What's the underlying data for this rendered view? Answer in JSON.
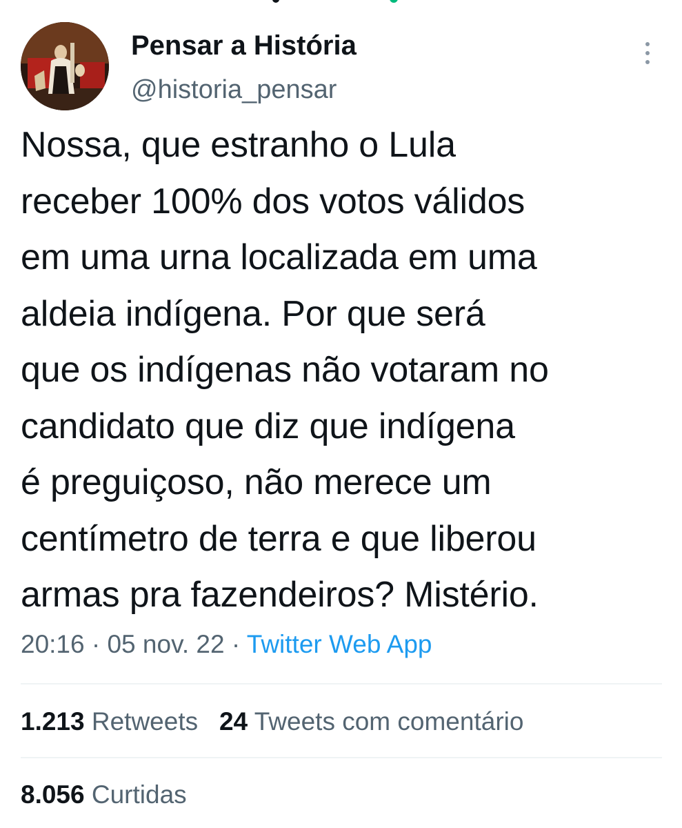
{
  "colors": {
    "text_primary": "#0f1419",
    "text_secondary": "#536471",
    "link": "#1d9bf0",
    "divider": "#eff3f4"
  },
  "header": {
    "display_name": "Pensar a História",
    "handle": "@historia_pensar",
    "more_icon": "more-vertical-icon"
  },
  "tweet": {
    "text": "Nossa, que estranho o Lula\nreceber 100% dos votos válidos\nem uma urna localizada em uma\naldeia indígena. Por que será\nque os indígenas não votaram no\ncandidato que diz que indígena\né preguiçoso, não merece um\ncentímetro de terra e que liberou\narmas pra fazendeiros? Mistério."
  },
  "meta": {
    "time": "20:16",
    "separator": " · ",
    "date": "05 nov. 22",
    "source": "Twitter Web App"
  },
  "stats": {
    "retweets_count": "1.213",
    "retweets_label": "Retweets",
    "quotes_count": "24",
    "quotes_label": "Tweets com comentário",
    "likes_count": "8.056",
    "likes_label": "Curtidas"
  }
}
